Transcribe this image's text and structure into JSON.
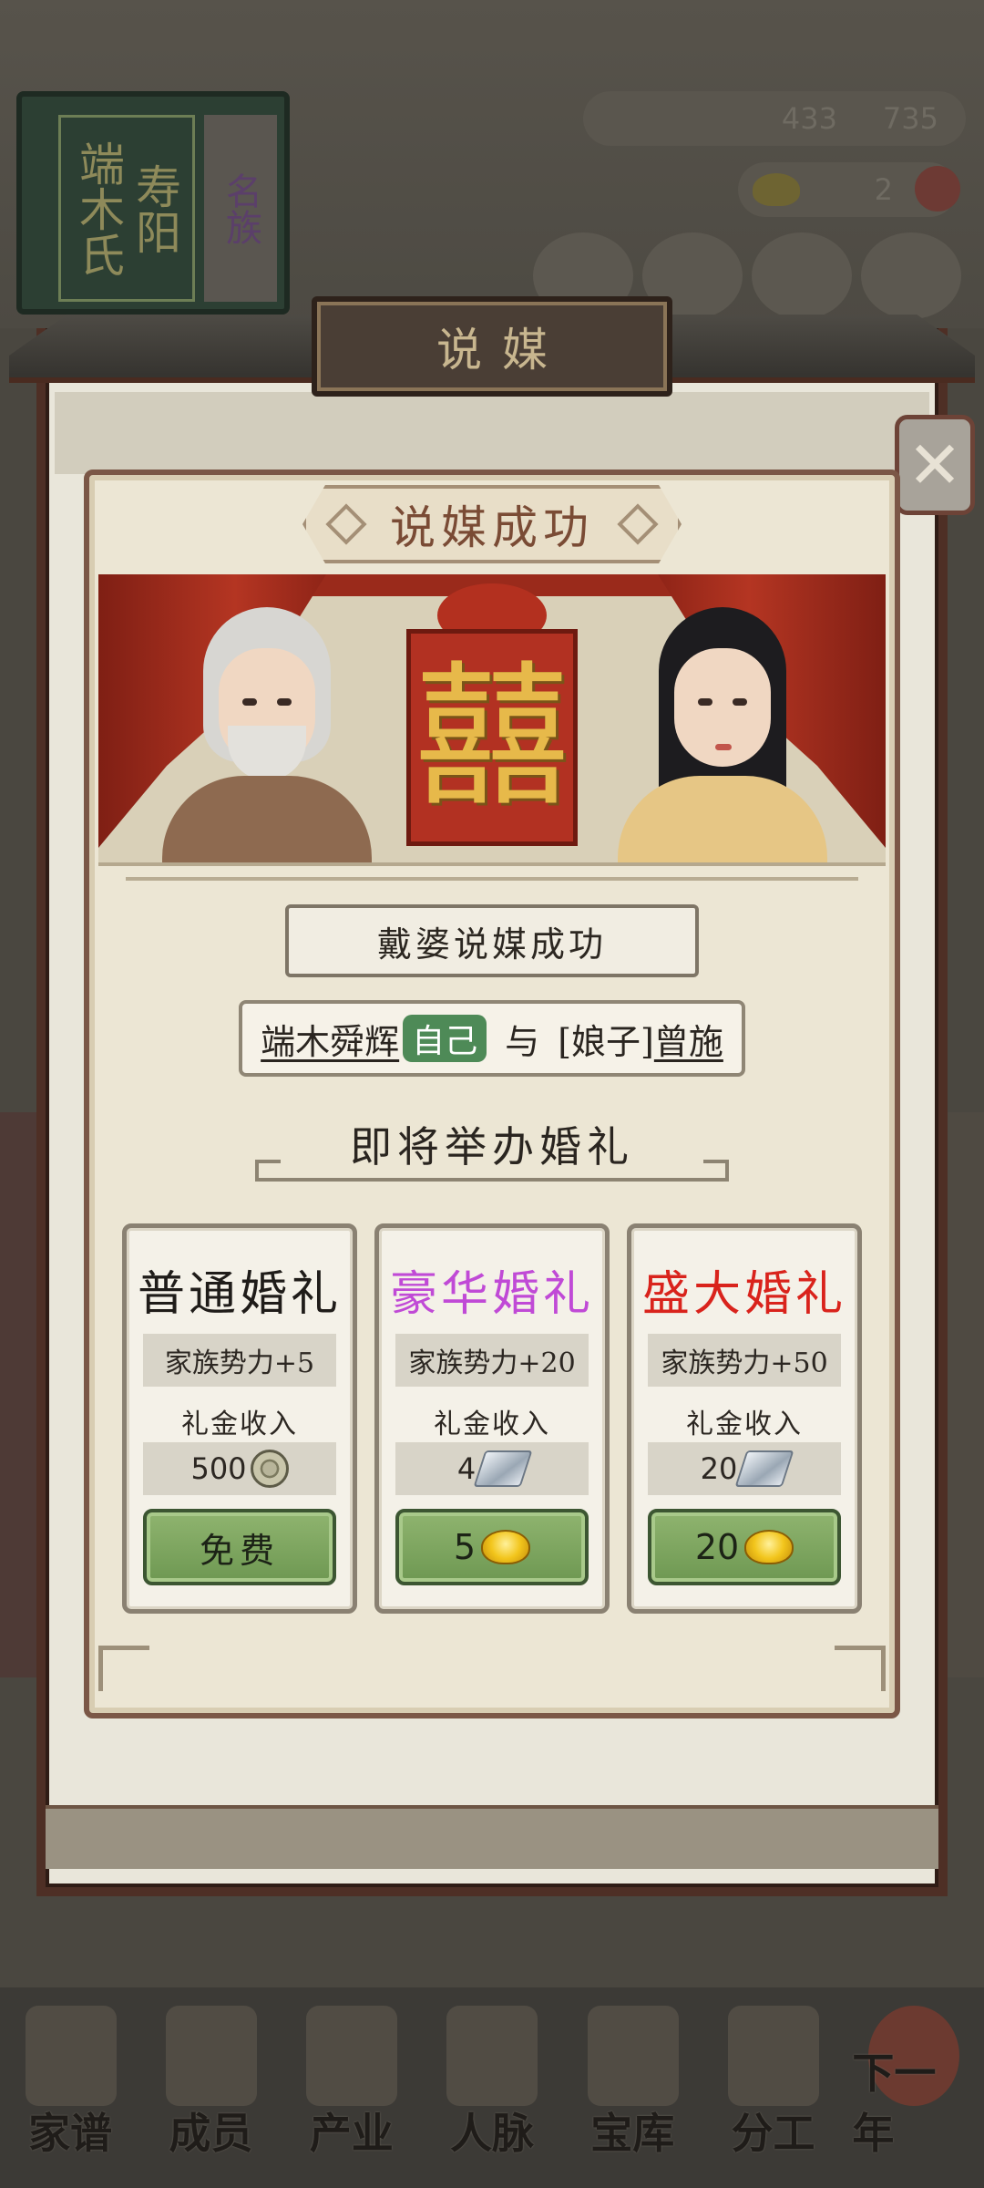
{
  "background": {
    "book_surname": "寿阳",
    "book_clan": "端木氏",
    "book_tag": "名族",
    "currency_silver": "433",
    "currency_coins": "735",
    "gold_count": "2",
    "bottom_nav": [
      "家谱",
      "成员",
      "产业",
      "人脉",
      "宝库",
      "分工",
      "下一年"
    ]
  },
  "dialog": {
    "title": "说媒",
    "close_icon": "close-x-icon",
    "banner": "说媒成功",
    "scene_symbol": "囍",
    "result_text": "戴婆说媒成功",
    "groom_name": "端木舜辉",
    "self_tag": "自己",
    "conjunction": "与",
    "bride_prefix": "[娘子]",
    "bride_name": "曾施",
    "section_title": "即将举办婚礼"
  },
  "weddings": [
    {
      "name": "普通婚礼",
      "color": "#1f1c19",
      "influence": "家族势力+5",
      "income_label": "礼金收入",
      "income_value": "500",
      "income_icon": "copper-coin-icon",
      "cost_label": "免费",
      "cost_value": "",
      "cost_icon": ""
    },
    {
      "name": "豪华婚礼",
      "color": "#c04ad6",
      "influence": "家族势力+20",
      "income_label": "礼金收入",
      "income_value": "4",
      "income_icon": "silver-ingot-icon",
      "cost_label": "",
      "cost_value": "5",
      "cost_icon": "gold-ingot-icon"
    },
    {
      "name": "盛大婚礼",
      "color": "#d9231c",
      "influence": "家族势力+50",
      "income_label": "礼金收入",
      "income_value": "20",
      "income_icon": "silver-ingot-icon",
      "cost_label": "",
      "cost_value": "20",
      "cost_icon": "gold-ingot-icon"
    }
  ]
}
